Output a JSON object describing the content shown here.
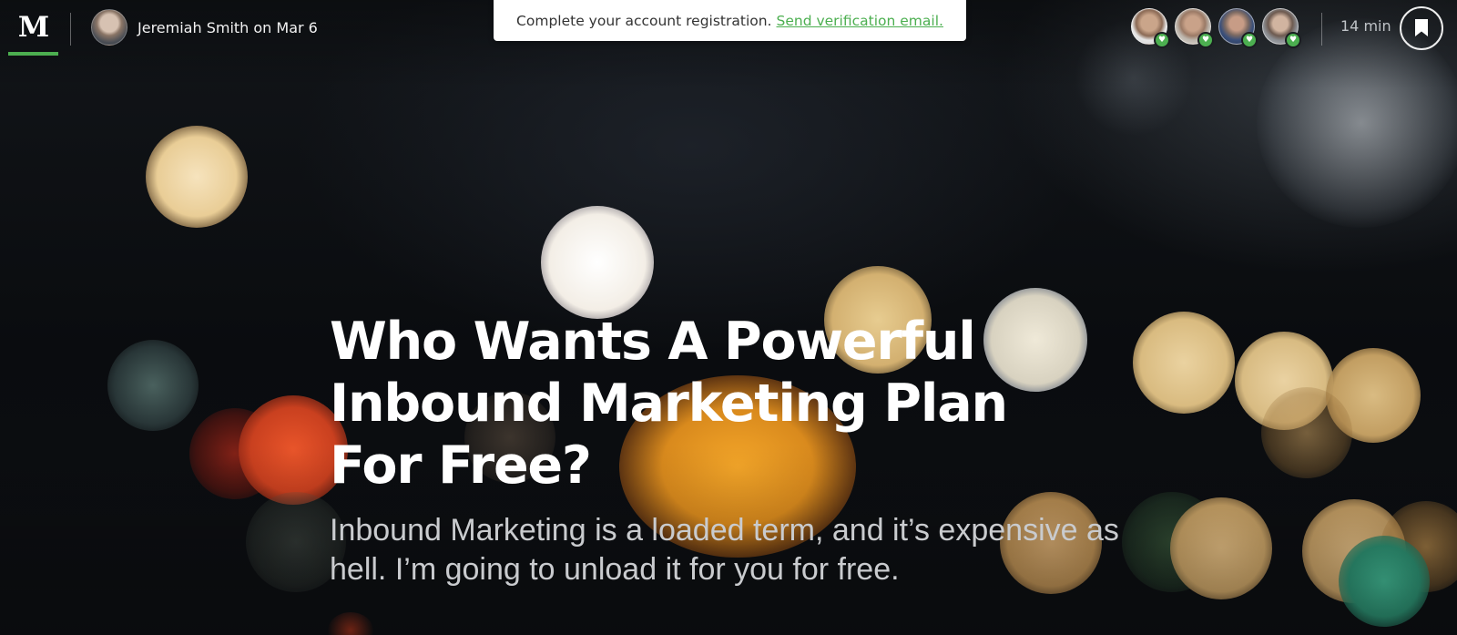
{
  "header": {
    "logo_text": "M",
    "author": {
      "byline": "Jeremiah Smith on Mar 6"
    },
    "notice": {
      "message": "Complete your account registration.",
      "link_label": "Send verification email."
    },
    "recommenders": [
      {
        "heart_icon": "heart-icon"
      },
      {
        "heart_icon": "heart-icon"
      },
      {
        "heart_icon": "heart-icon"
      },
      {
        "heart_icon": "heart-icon"
      }
    ],
    "read_time": "14 min",
    "bookmark_icon": "bookmark-icon"
  },
  "article": {
    "title": "Who Wants A Powerful Inbound Marketing Plan For Free?",
    "subtitle": "Inbound Marketing is a loaded term, and it’s expensive as hell. I’m going to unload it for you for free."
  },
  "colors": {
    "accent": "#4caf50",
    "notice_bg": "#ffffff",
    "title": "#ffffff",
    "subtitle": "#c9cbce"
  }
}
